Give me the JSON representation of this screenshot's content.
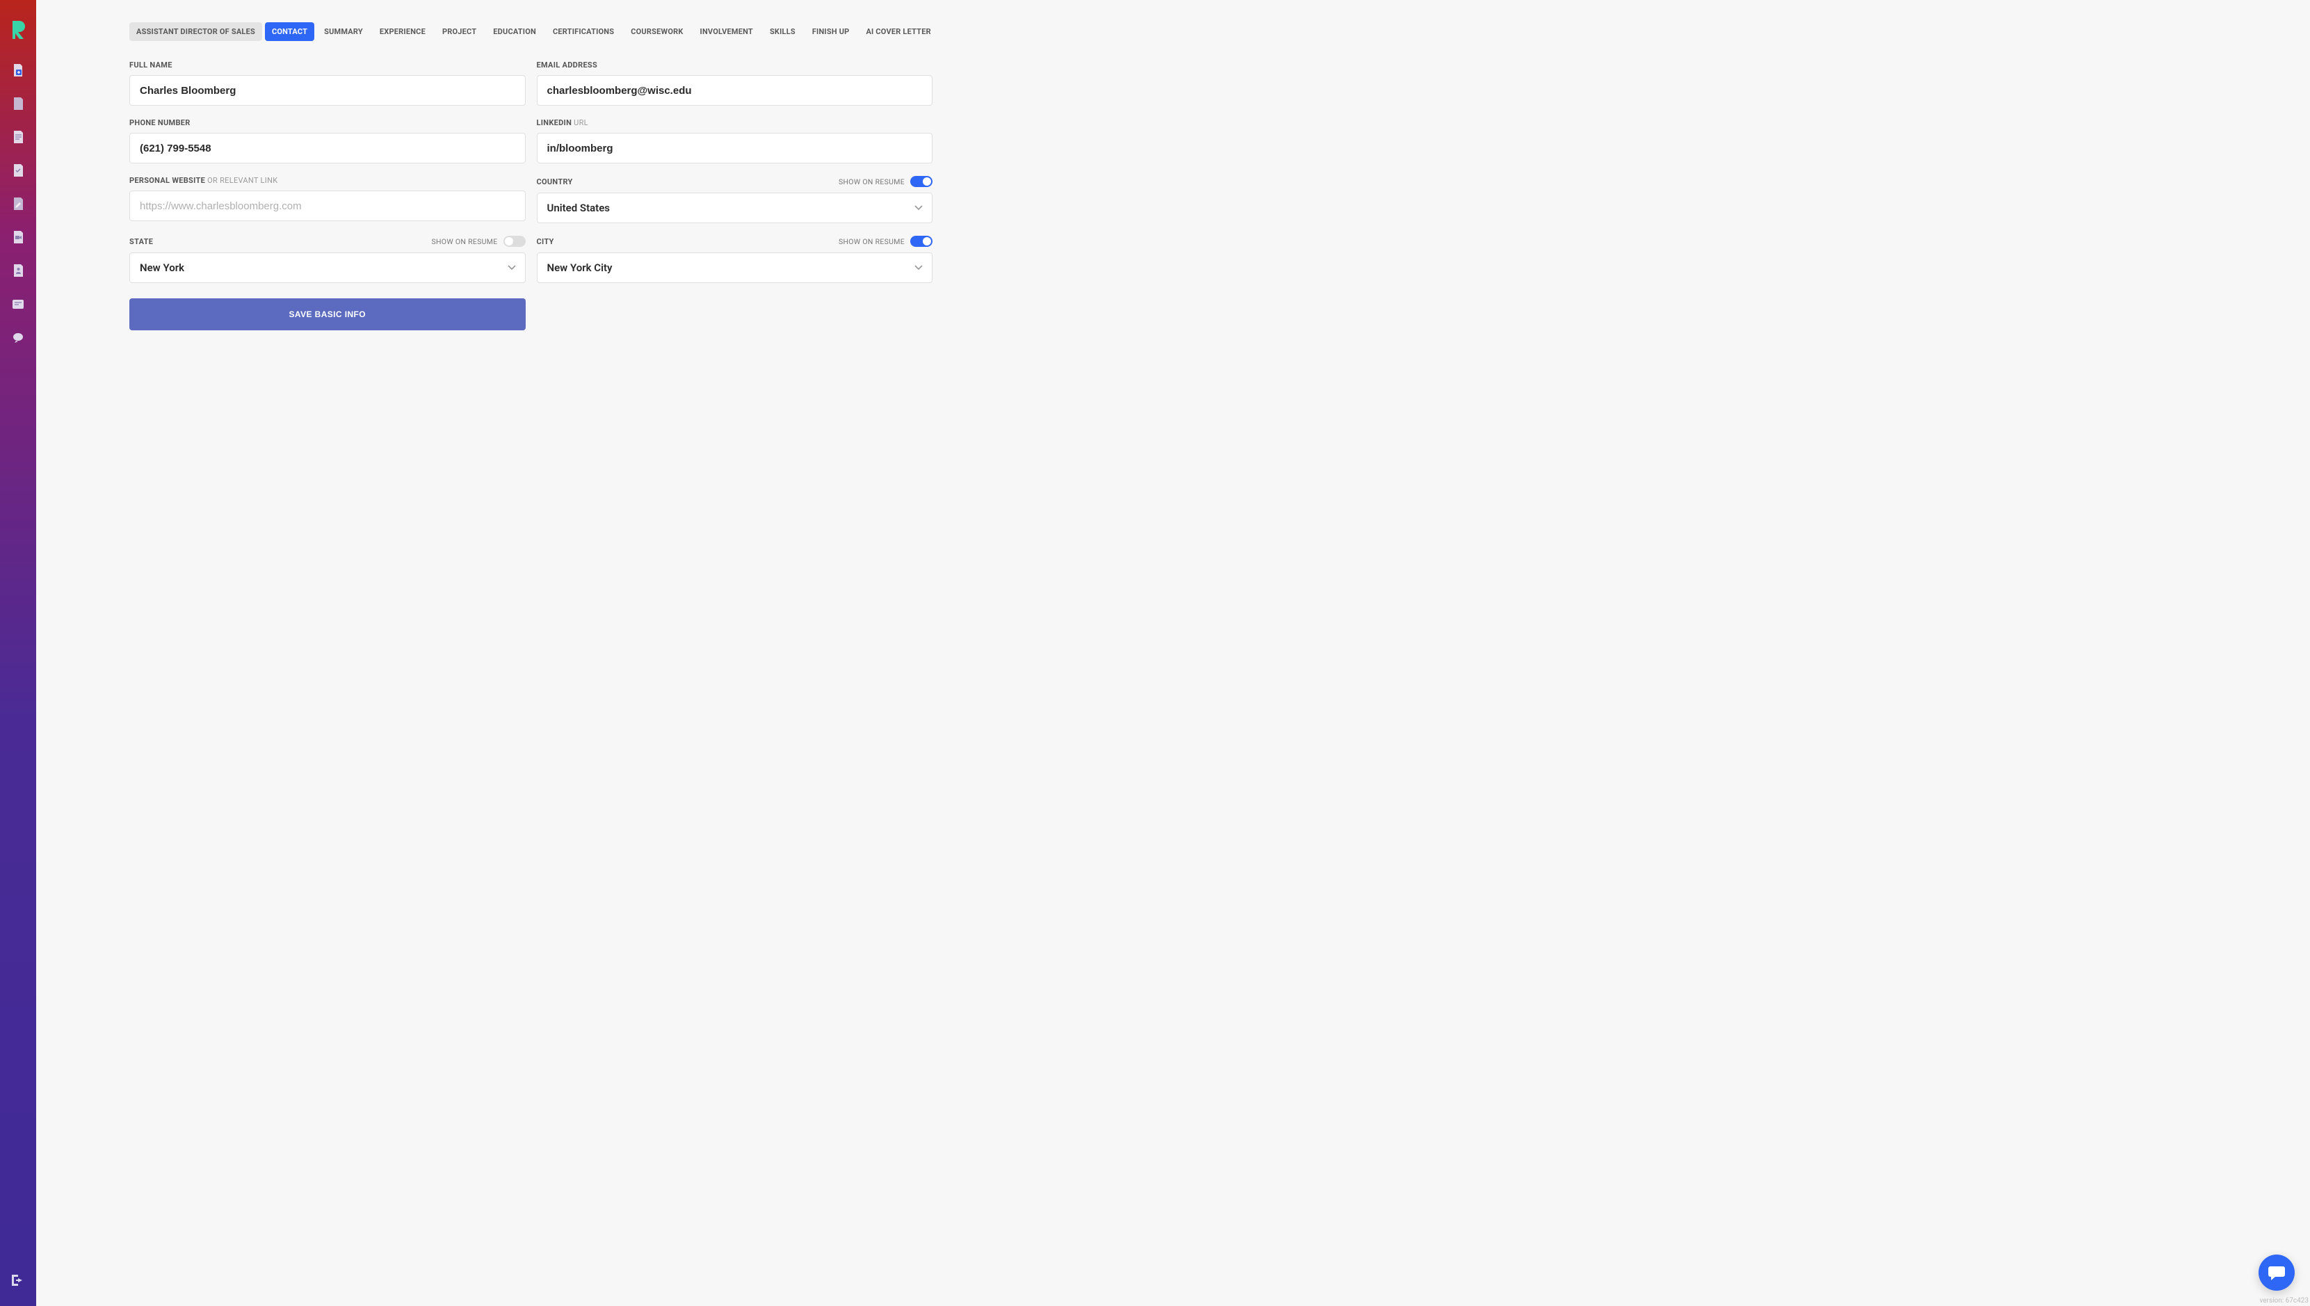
{
  "sidebar": {
    "items": [
      "plus",
      "doc",
      "doc-lines",
      "checklist",
      "pencil",
      "video",
      "profile",
      "card",
      "chat"
    ],
    "bottom": "logout"
  },
  "tabs": [
    {
      "label": "ASSISTANT DIRECTOR OF SALES",
      "state": "first"
    },
    {
      "label": "CONTACT",
      "state": "active"
    },
    {
      "label": "SUMMARY",
      "state": "normal"
    },
    {
      "label": "EXPERIENCE",
      "state": "normal"
    },
    {
      "label": "PROJECT",
      "state": "normal"
    },
    {
      "label": "EDUCATION",
      "state": "normal"
    },
    {
      "label": "CERTIFICATIONS",
      "state": "normal"
    },
    {
      "label": "COURSEWORK",
      "state": "normal"
    },
    {
      "label": "INVOLVEMENT",
      "state": "normal"
    },
    {
      "label": "SKILLS",
      "state": "normal"
    },
    {
      "label": "FINISH UP",
      "state": "normal"
    },
    {
      "label": "AI COVER LETTER",
      "state": "normal"
    }
  ],
  "fields": {
    "full_name": {
      "label": "FULL NAME",
      "value": "Charles Bloomberg"
    },
    "email": {
      "label": "EMAIL ADDRESS",
      "value": "charlesbloomberg@wisc.edu"
    },
    "phone": {
      "label": "PHONE NUMBER",
      "value": "(621) 799-5548"
    },
    "linkedin": {
      "label_main": "LINKEDIN",
      "label_sub": " URL",
      "value": "in/bloomberg"
    },
    "website": {
      "label_main": "PERSONAL WEBSITE",
      "label_sub": " OR RELEVANT LINK",
      "value": "",
      "placeholder": "https://www.charlesbloomberg.com"
    },
    "country": {
      "label": "COUNTRY",
      "value": "United States",
      "show_label": "SHOW ON RESUME",
      "show_on": true
    },
    "state": {
      "label": "STATE",
      "value": "New York",
      "show_label": "SHOW ON RESUME",
      "show_on": false
    },
    "city": {
      "label": "CITY",
      "value": "New York City",
      "show_label": "SHOW ON RESUME",
      "show_on": true
    }
  },
  "save_button": "SAVE BASIC INFO",
  "version": "version: 67c423"
}
